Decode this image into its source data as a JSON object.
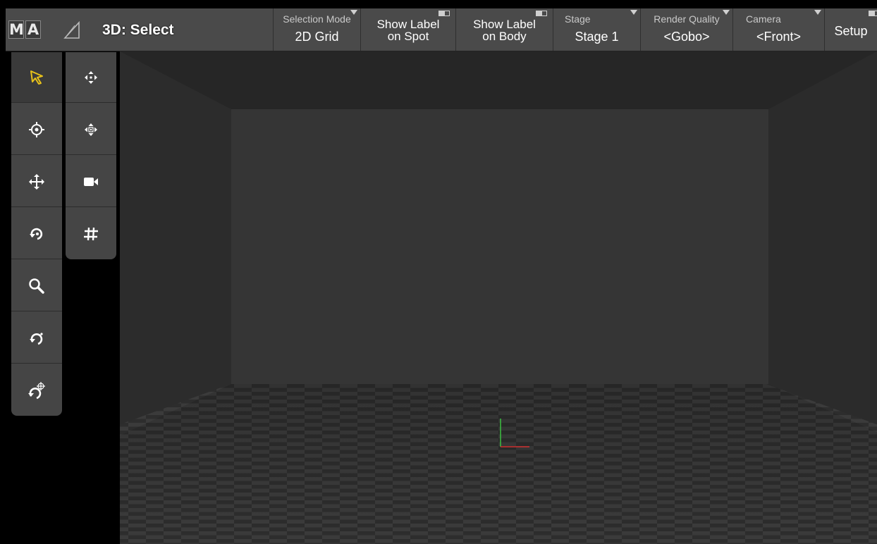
{
  "logo": {
    "letter1": "M",
    "letter2": "A"
  },
  "view": {
    "title": "3D: Select",
    "icon": "stage-view-icon"
  },
  "toolbar": {
    "selection_mode": {
      "label": "Selection Mode",
      "value": "2D Grid"
    },
    "show_label_spot": {
      "line1": "Show Label",
      "line2": "on Spot"
    },
    "show_label_body": {
      "line1": "Show Label",
      "line2": "on Body"
    },
    "stage": {
      "label": "Stage",
      "value": "Stage 1"
    },
    "render_quality": {
      "label": "Render Quality",
      "value": "<Gobo>"
    },
    "camera": {
      "label": "Camera",
      "value": "<Front>"
    },
    "setup": {
      "label": "Setup"
    }
  },
  "tools_left": [
    "select-arrow-icon",
    "crosshair-icon",
    "move-arrows-icon",
    "rotate-icon",
    "zoom-icon",
    "orbit-icon",
    "orbit-point-icon"
  ],
  "tools_right": [
    "pan-arrows-icon",
    "pan-target-icon",
    "camera-icon",
    "grid-icon"
  ],
  "colors": {
    "accent": "#e8c21a",
    "axis_x": "#d03030",
    "axis_y": "#3cc040",
    "bar": "#4a4a4a"
  }
}
